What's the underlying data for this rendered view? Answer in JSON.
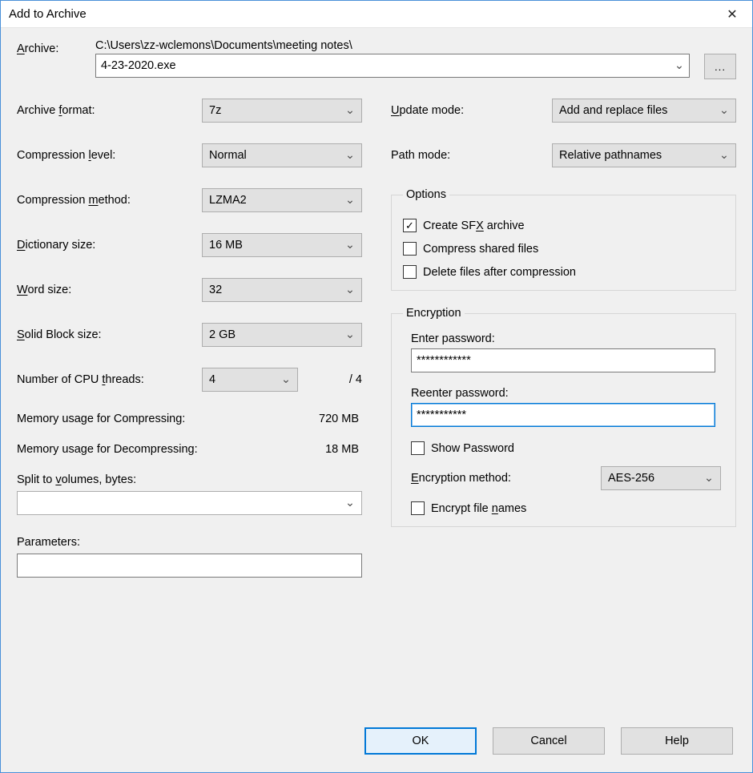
{
  "window": {
    "title": "Add to Archive",
    "close_glyph": "✕"
  },
  "archive": {
    "label": "Archive:",
    "label_u": "A",
    "path_dir": "C:\\Users\\zz-wclemons\\Documents\\meeting notes\\",
    "filename": "4-23-2020.exe",
    "browse_label": "..."
  },
  "left": {
    "format": {
      "label": "Archive format:",
      "u": "f",
      "value": "7z"
    },
    "level": {
      "label": "Compression level:",
      "u": "l",
      "value": "Normal"
    },
    "method": {
      "label": "Compression method:",
      "u": "m",
      "value": "LZMA2"
    },
    "dict": {
      "label": "Dictionary size:",
      "u": "D",
      "value": "16 MB"
    },
    "word": {
      "label": "Word size:",
      "u": "W",
      "value": "32"
    },
    "solid": {
      "label": "Solid Block size:",
      "u": "S",
      "value": "2 GB"
    },
    "threads": {
      "label": "Number of CPU threads:",
      "u": "t",
      "value": "4",
      "max": "/ 4"
    },
    "mem_compress": {
      "label": "Memory usage for Compressing:",
      "value": "720 MB"
    },
    "mem_decompress": {
      "label": "Memory usage for Decompressing:",
      "value": "18 MB"
    },
    "split": {
      "label": "Split to volumes, bytes:",
      "u": "v",
      "value": ""
    },
    "params": {
      "label": "Parameters:",
      "value": ""
    }
  },
  "right": {
    "update": {
      "label": "Update mode:",
      "u": "U",
      "value": "Add and replace files"
    },
    "pathmode": {
      "label": "Path mode:",
      "value": "Relative pathnames"
    },
    "options": {
      "legend": "Options",
      "sfx": {
        "label": "Create SFX archive",
        "u": "X",
        "checked": true
      },
      "shared": {
        "label": "Compress shared files",
        "checked": false
      },
      "delete": {
        "label": "Delete files after compression",
        "checked": false
      }
    },
    "encryption": {
      "legend": "Encryption",
      "enter": {
        "label": "Enter password:",
        "value": "************"
      },
      "reenter": {
        "label": "Reenter password:",
        "value": "***********"
      },
      "show": {
        "label": "Show Password",
        "checked": false
      },
      "method": {
        "label": "Encryption method:",
        "u": "E",
        "value": "AES-256"
      },
      "encrypt_names": {
        "label": "Encrypt file names",
        "u": "n",
        "checked": false
      }
    }
  },
  "buttons": {
    "ok": "OK",
    "cancel": "Cancel",
    "help": "Help"
  },
  "icons": {
    "chevron_down": "⌄"
  }
}
